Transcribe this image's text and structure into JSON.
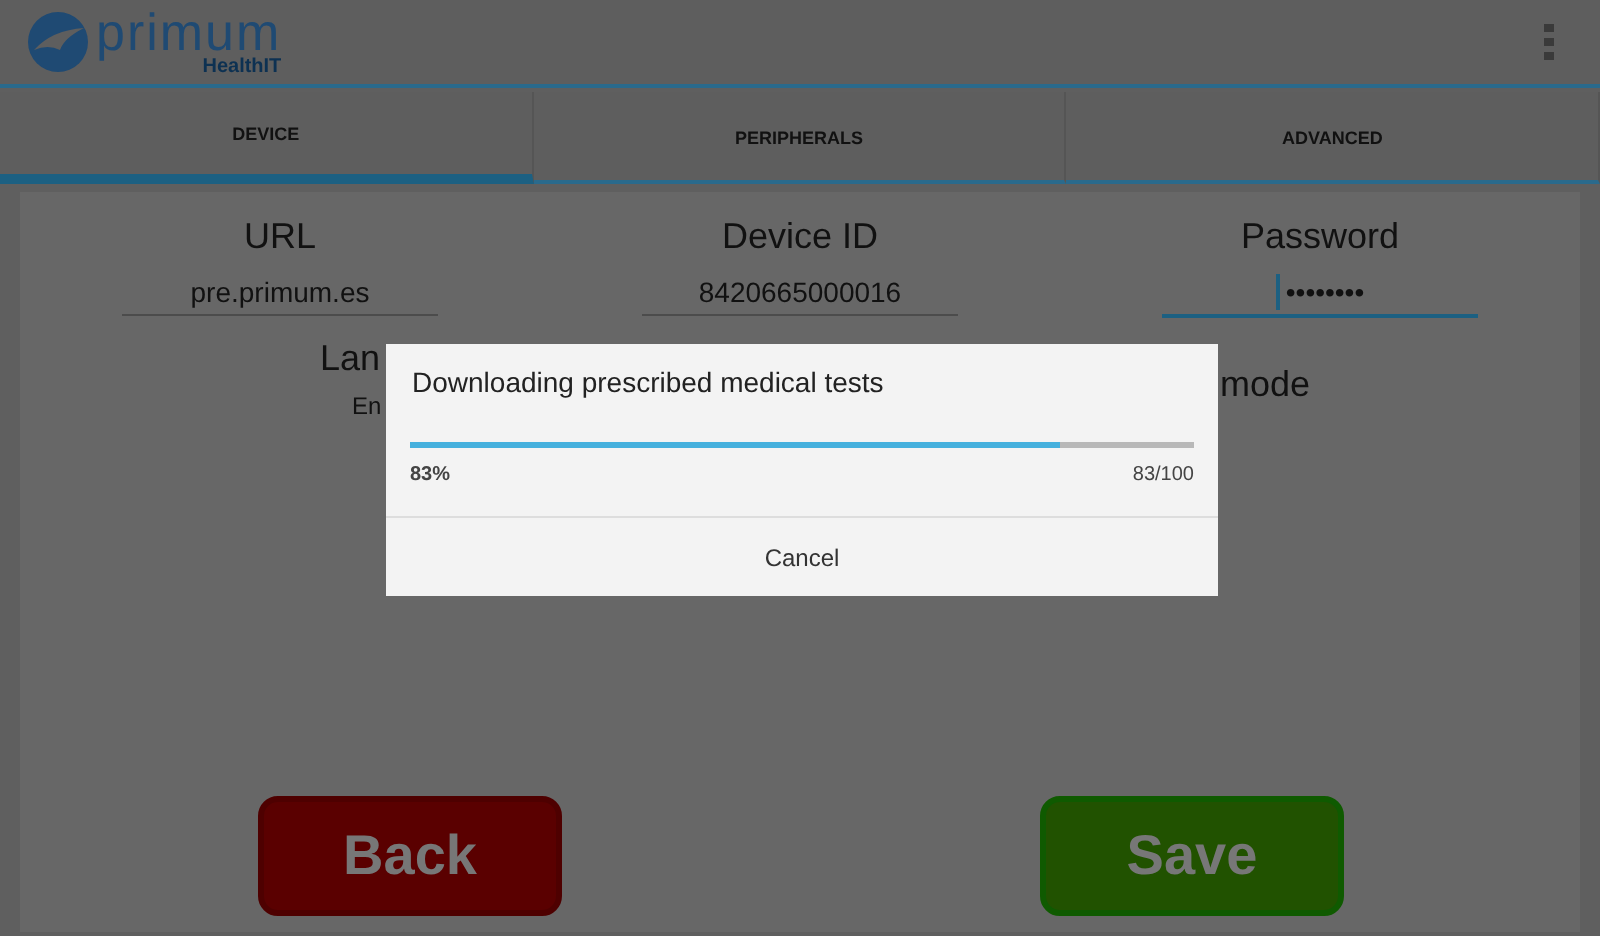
{
  "header": {
    "logo_text": "primum",
    "logo_subtext": "HealthIT"
  },
  "tabs": [
    {
      "label": "DEVICE",
      "selected": true
    },
    {
      "label": "PERIPHERALS",
      "selected": false
    },
    {
      "label": "ADVANCED",
      "selected": false
    }
  ],
  "fields": [
    {
      "label": "URL",
      "value": "pre.primum.es",
      "focused": false
    },
    {
      "label": "Device ID",
      "value": "8420665000016",
      "focused": false
    },
    {
      "label": "Password",
      "value": "••••••••",
      "focused": true
    }
  ],
  "partial_fields": {
    "left_label": "Lan",
    "left_value": "En",
    "right_label": "mode"
  },
  "dialog": {
    "title": "Downloading prescribed medical tests",
    "level": 0.83,
    "percent": "83%",
    "count": "83/100",
    "cancel": "Cancel"
  },
  "buttons": [
    {
      "label": "Back",
      "kind": "back"
    },
    {
      "label": "Save",
      "kind": "save"
    }
  ]
}
